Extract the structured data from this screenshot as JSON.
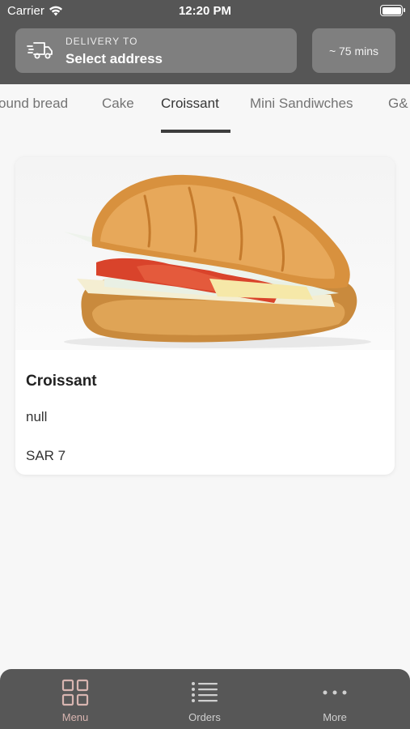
{
  "status_bar": {
    "carrier": "Carrier",
    "time": "12:20 PM"
  },
  "header": {
    "delivery_label": "DELIVERY TO",
    "delivery_value": "Select address",
    "eta": "~ 75 mins"
  },
  "tabs": [
    {
      "label": "ound bread"
    },
    {
      "label": "Cake"
    },
    {
      "label": "Croissant",
      "active": true
    },
    {
      "label": "Mini Sandiwches"
    },
    {
      "label": "G&"
    }
  ],
  "product": {
    "title": "Croissant",
    "description": "null",
    "price": "SAR 7"
  },
  "bottom_nav": [
    {
      "label": "Menu",
      "icon": "grid-icon",
      "active": true
    },
    {
      "label": "Orders",
      "icon": "list-icon"
    },
    {
      "label": "More",
      "icon": "more-dots-icon"
    }
  ],
  "colors": {
    "header_bg": "#565656",
    "accent": "#d8b5b0",
    "nav_bg": "#575757"
  }
}
